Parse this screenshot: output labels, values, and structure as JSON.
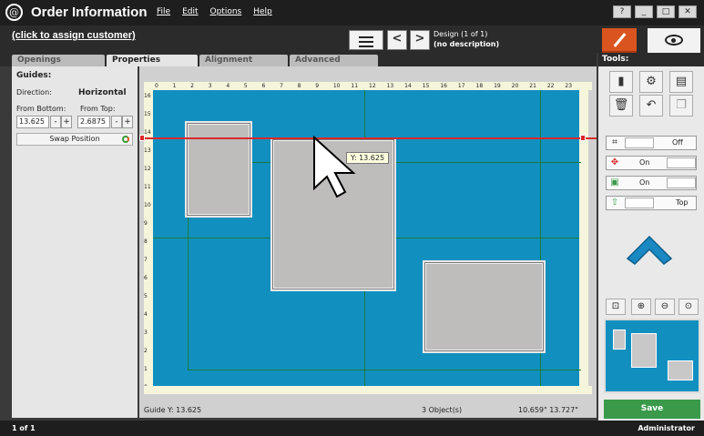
{
  "app": {
    "logo": "@",
    "title": "Order Information"
  },
  "menu": [
    "File",
    "Edit",
    "Options",
    "Help"
  ],
  "window_buttons": [
    "?",
    "_",
    "□",
    "✕"
  ],
  "customer_link": "(click to assign customer)",
  "design": {
    "line1": "Design  (1 of 1)",
    "line2": "(no description)"
  },
  "nav": {
    "prev": "<",
    "next": ">"
  },
  "tabs": [
    "Openings",
    "Properties",
    "Alignment",
    "Advanced"
  ],
  "active_tab": "Properties",
  "guides": {
    "title": "Guides:",
    "direction_label": "Direction:",
    "direction_value": "Horizontal",
    "from_bottom_label": "From Bottom:",
    "from_top_label": "From Top:",
    "from_bottom_value": "13.625",
    "from_top_value": "2.6875",
    "swap_label": "Swap Position"
  },
  "stepper": {
    "minus": "-",
    "plus": "+"
  },
  "ruler": {
    "top": [
      "0",
      "1",
      "2",
      "3",
      "4",
      "5",
      "6",
      "7",
      "8",
      "9",
      "10",
      "11",
      "12",
      "13",
      "14",
      "15",
      "16",
      "17",
      "18",
      "19",
      "20",
      "21",
      "22",
      "23"
    ],
    "left": [
      "16",
      "15",
      "14",
      "13",
      "12",
      "11",
      "10",
      "9",
      "8",
      "7",
      "6",
      "5",
      "4",
      "3",
      "2",
      "1",
      "0"
    ]
  },
  "tooltip": "Y: 13.625",
  "status": {
    "guide": "Guide  Y: 13.625",
    "objects": "3 Object(s)",
    "dimensions": "10.659\"  13.727\""
  },
  "tools": {
    "label": "Tools:",
    "toggles": [
      {
        "icon": "resize-icon",
        "state": "Off"
      },
      {
        "icon": "move-icon",
        "state": "On"
      },
      {
        "icon": "frame-icon",
        "state": "On"
      },
      {
        "icon": "arrow-up-icon",
        "state": "Top"
      }
    ]
  },
  "save_label": "Save",
  "footer": {
    "page": "1 of 1",
    "user": "Administrator"
  },
  "colors": {
    "mat": "#1190c0",
    "guide": "#d9282a",
    "save": "#3a9a4a",
    "edit": "#d9541e"
  }
}
